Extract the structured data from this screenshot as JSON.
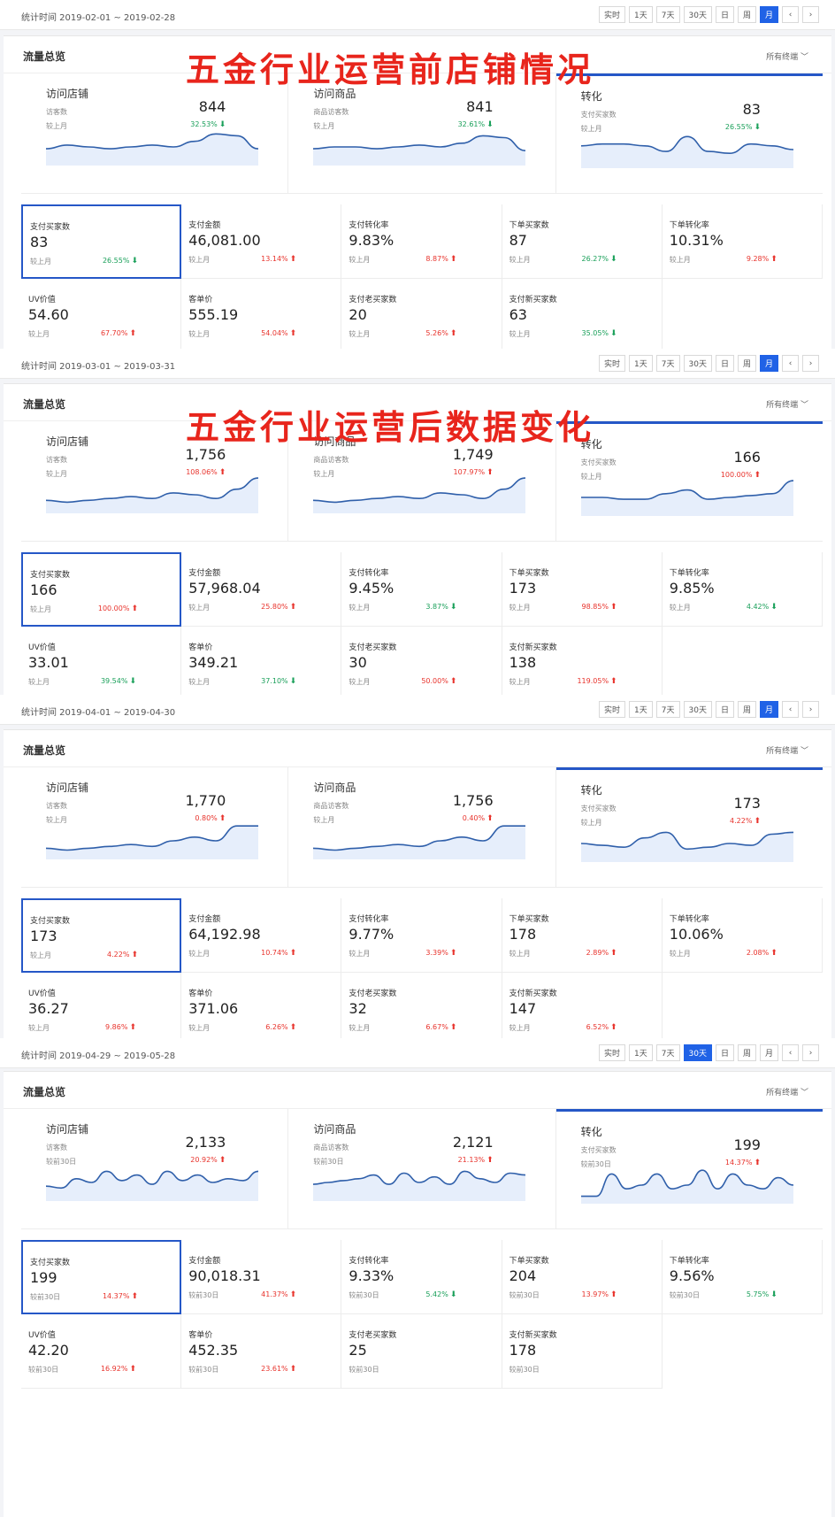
{
  "overlays": {
    "before": "五金行业运营前店铺情况",
    "after": "五金行业运营后数据变化"
  },
  "colors": {
    "up": "#e8332c",
    "down": "#1aa05a",
    "accent": "#2062e6",
    "selected_border": "#2557c7",
    "overlay_text": "#e8251c"
  },
  "sections": [
    {
      "date_range": "统计时间 2019-02-01 ~ 2019-02-28",
      "ranges": [
        "实时",
        "1天",
        "7天",
        "30天",
        "日",
        "周",
        "月",
        "‹",
        "›"
      ],
      "active_range": "月",
      "card_title": "流量总览",
      "terminal": "所有终端 ﹀",
      "panels": [
        {
          "title": "访问店铺",
          "label1": "访客数",
          "label2": "较上月",
          "value": "844",
          "change": "32.53%",
          "dir": "down"
        },
        {
          "title": "访问商品",
          "label1": "商品访客数",
          "label2": "较上月",
          "value": "841",
          "change": "32.61%",
          "dir": "down"
        },
        {
          "title": "转化",
          "label1": "支付买家数",
          "label2": "较上月",
          "value": "83",
          "change": "26.55%",
          "dir": "down"
        }
      ],
      "metrics": [
        {
          "label": "支付买家数",
          "value": "83",
          "cmp": "较上月",
          "change": "26.55%",
          "dir": "down"
        },
        {
          "label": "支付金额",
          "value": "46,081.00",
          "cmp": "较上月",
          "change": "13.14%",
          "dir": "up"
        },
        {
          "label": "支付转化率",
          "value": "9.83%",
          "cmp": "较上月",
          "change": "8.87%",
          "dir": "up"
        },
        {
          "label": "下单买家数",
          "value": "87",
          "cmp": "较上月",
          "change": "26.27%",
          "dir": "down"
        },
        {
          "label": "下单转化率",
          "value": "10.31%",
          "cmp": "较上月",
          "change": "9.28%",
          "dir": "up"
        },
        {
          "label": "UV价值",
          "value": "54.60",
          "cmp": "较上月",
          "change": "67.70%",
          "dir": "up"
        },
        {
          "label": "客单价",
          "value": "555.19",
          "cmp": "较上月",
          "change": "54.04%",
          "dir": "up"
        },
        {
          "label": "支付老买家数",
          "value": "20",
          "cmp": "较上月",
          "change": "5.26%",
          "dir": "up"
        },
        {
          "label": "支付新买家数",
          "value": "63",
          "cmp": "较上月",
          "change": "35.05%",
          "dir": "down"
        }
      ]
    },
    {
      "date_range": "统计时间 2019-03-01 ~ 2019-03-31",
      "ranges": [
        "实时",
        "1天",
        "7天",
        "30天",
        "日",
        "周",
        "月",
        "‹",
        "›"
      ],
      "active_range": "月",
      "card_title": "流量总览",
      "terminal": "所有终端 ﹀",
      "panels": [
        {
          "title": "访问店铺",
          "label1": "访客数",
          "label2": "较上月",
          "value": "1,756",
          "change": "108.06%",
          "dir": "up"
        },
        {
          "title": "访问商品",
          "label1": "商品访客数",
          "label2": "较上月",
          "value": "1,749",
          "change": "107.97%",
          "dir": "up"
        },
        {
          "title": "转化",
          "label1": "支付买家数",
          "label2": "较上月",
          "value": "166",
          "change": "100.00%",
          "dir": "up"
        }
      ],
      "metrics": [
        {
          "label": "支付买家数",
          "value": "166",
          "cmp": "较上月",
          "change": "100.00%",
          "dir": "up"
        },
        {
          "label": "支付金额",
          "value": "57,968.04",
          "cmp": "较上月",
          "change": "25.80%",
          "dir": "up"
        },
        {
          "label": "支付转化率",
          "value": "9.45%",
          "cmp": "较上月",
          "change": "3.87%",
          "dir": "down"
        },
        {
          "label": "下单买家数",
          "value": "173",
          "cmp": "较上月",
          "change": "98.85%",
          "dir": "up"
        },
        {
          "label": "下单转化率",
          "value": "9.85%",
          "cmp": "较上月",
          "change": "4.42%",
          "dir": "down"
        },
        {
          "label": "UV价值",
          "value": "33.01",
          "cmp": "较上月",
          "change": "39.54%",
          "dir": "down"
        },
        {
          "label": "客单价",
          "value": "349.21",
          "cmp": "较上月",
          "change": "37.10%",
          "dir": "down"
        },
        {
          "label": "支付老买家数",
          "value": "30",
          "cmp": "较上月",
          "change": "50.00%",
          "dir": "up"
        },
        {
          "label": "支付新买家数",
          "value": "138",
          "cmp": "较上月",
          "change": "119.05%",
          "dir": "up"
        }
      ]
    },
    {
      "date_range": "统计时间 2019-04-01 ~ 2019-04-30",
      "ranges": [
        "实时",
        "1天",
        "7天",
        "30天",
        "日",
        "周",
        "月",
        "‹",
        "›"
      ],
      "active_range": "月",
      "card_title": "流量总览",
      "terminal": "所有终端 ﹀",
      "panels": [
        {
          "title": "访问店铺",
          "label1": "访客数",
          "label2": "较上月",
          "value": "1,770",
          "change": "0.80%",
          "dir": "up"
        },
        {
          "title": "访问商品",
          "label1": "商品访客数",
          "label2": "较上月",
          "value": "1,756",
          "change": "0.40%",
          "dir": "up"
        },
        {
          "title": "转化",
          "label1": "支付买家数",
          "label2": "较上月",
          "value": "173",
          "change": "4.22%",
          "dir": "up"
        }
      ],
      "metrics": [
        {
          "label": "支付买家数",
          "value": "173",
          "cmp": "较上月",
          "change": "4.22%",
          "dir": "up"
        },
        {
          "label": "支付金额",
          "value": "64,192.98",
          "cmp": "较上月",
          "change": "10.74%",
          "dir": "up"
        },
        {
          "label": "支付转化率",
          "value": "9.77%",
          "cmp": "较上月",
          "change": "3.39%",
          "dir": "up"
        },
        {
          "label": "下单买家数",
          "value": "178",
          "cmp": "较上月",
          "change": "2.89%",
          "dir": "up"
        },
        {
          "label": "下单转化率",
          "value": "10.06%",
          "cmp": "较上月",
          "change": "2.08%",
          "dir": "up"
        },
        {
          "label": "UV价值",
          "value": "36.27",
          "cmp": "较上月",
          "change": "9.86%",
          "dir": "up"
        },
        {
          "label": "客单价",
          "value": "371.06",
          "cmp": "较上月",
          "change": "6.26%",
          "dir": "up"
        },
        {
          "label": "支付老买家数",
          "value": "32",
          "cmp": "较上月",
          "change": "6.67%",
          "dir": "up"
        },
        {
          "label": "支付新买家数",
          "value": "147",
          "cmp": "较上月",
          "change": "6.52%",
          "dir": "up"
        }
      ]
    },
    {
      "date_range": "统计时间 2019-04-29 ~ 2019-05-28",
      "ranges": [
        "实时",
        "1天",
        "7天",
        "30天",
        "日",
        "周",
        "月",
        "‹",
        "›"
      ],
      "active_range": "30天",
      "card_title": "流量总览",
      "terminal": "所有终端 ﹀",
      "panels": [
        {
          "title": "访问店铺",
          "label1": "访客数",
          "label2": "较前30日",
          "value": "2,133",
          "change": "20.92%",
          "dir": "up"
        },
        {
          "title": "访问商品",
          "label1": "商品访客数",
          "label2": "较前30日",
          "value": "2,121",
          "change": "21.13%",
          "dir": "up"
        },
        {
          "title": "转化",
          "label1": "支付买家数",
          "label2": "较前30日",
          "value": "199",
          "change": "14.37%",
          "dir": "up"
        }
      ],
      "metrics": [
        {
          "label": "支付买家数",
          "value": "199",
          "cmp": "较前30日",
          "change": "14.37%",
          "dir": "up"
        },
        {
          "label": "支付金额",
          "value": "90,018.31",
          "cmp": "较前30日",
          "change": "41.37%",
          "dir": "up"
        },
        {
          "label": "支付转化率",
          "value": "9.33%",
          "cmp": "较前30日",
          "change": "5.42%",
          "dir": "down"
        },
        {
          "label": "下单买家数",
          "value": "204",
          "cmp": "较前30日",
          "change": "13.97%",
          "dir": "up"
        },
        {
          "label": "下单转化率",
          "value": "9.56%",
          "cmp": "较前30日",
          "change": "5.75%",
          "dir": "down"
        },
        {
          "label": "UV价值",
          "value": "42.20",
          "cmp": "较前30日",
          "change": "16.92%",
          "dir": "up"
        },
        {
          "label": "客单价",
          "value": "452.35",
          "cmp": "较前30日",
          "change": "23.61%",
          "dir": "up"
        },
        {
          "label": "支付老买家数",
          "value": "25",
          "cmp": "较前30日",
          "change": "",
          "dir": ""
        },
        {
          "label": "支付新买家数",
          "value": "178",
          "cmp": "较前30日",
          "change": "",
          "dir": ""
        }
      ]
    }
  ]
}
